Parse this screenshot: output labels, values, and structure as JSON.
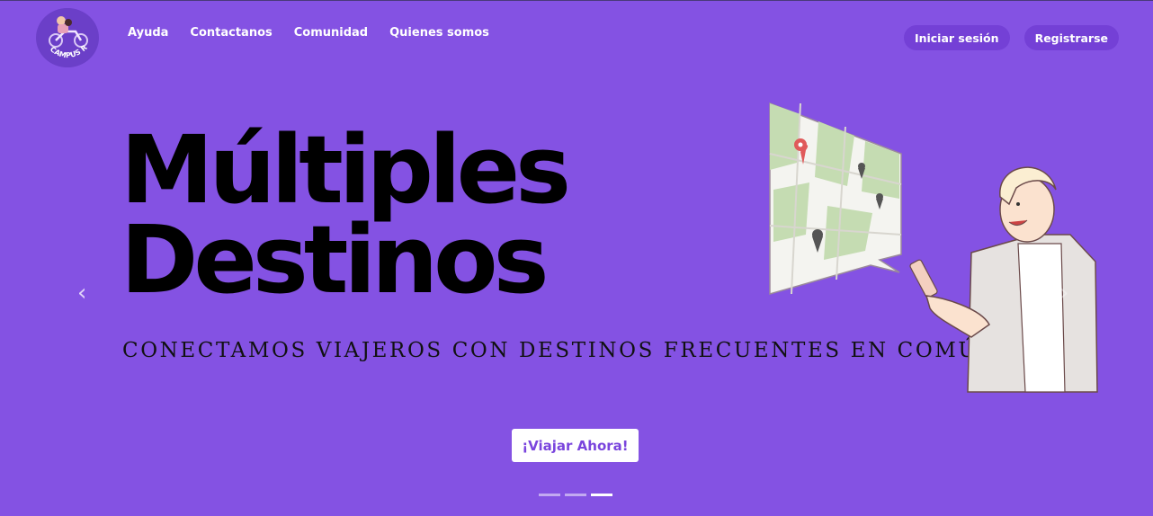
{
  "brand": {
    "logo_text": "CAMPUS RIDE"
  },
  "nav": {
    "links": [
      {
        "label": "Ayuda"
      },
      {
        "label": "Contactanos"
      },
      {
        "label": "Comunidad"
      },
      {
        "label": "Quienes somos"
      }
    ]
  },
  "auth": {
    "login_label": "Iniciar sesión",
    "register_label": "Registrarse"
  },
  "hero": {
    "title_line1": "Múltiples",
    "title_line2": "Destinos",
    "subtitle": "CONECTAMOS VIAJEROS CON DESTINOS FRECUENTES EN COMÚN",
    "cta_label": "¡Viajar Ahora!"
  },
  "carousel": {
    "prev_icon": "chevron-left-icon",
    "next_icon": "chevron-right-icon",
    "prev_glyph": "‹",
    "next_glyph": "›",
    "slide_count": 3,
    "active_slide": 3
  },
  "colors": {
    "background": "#8452e3",
    "button": "#7440d6",
    "cta_text": "#7a45dd"
  }
}
